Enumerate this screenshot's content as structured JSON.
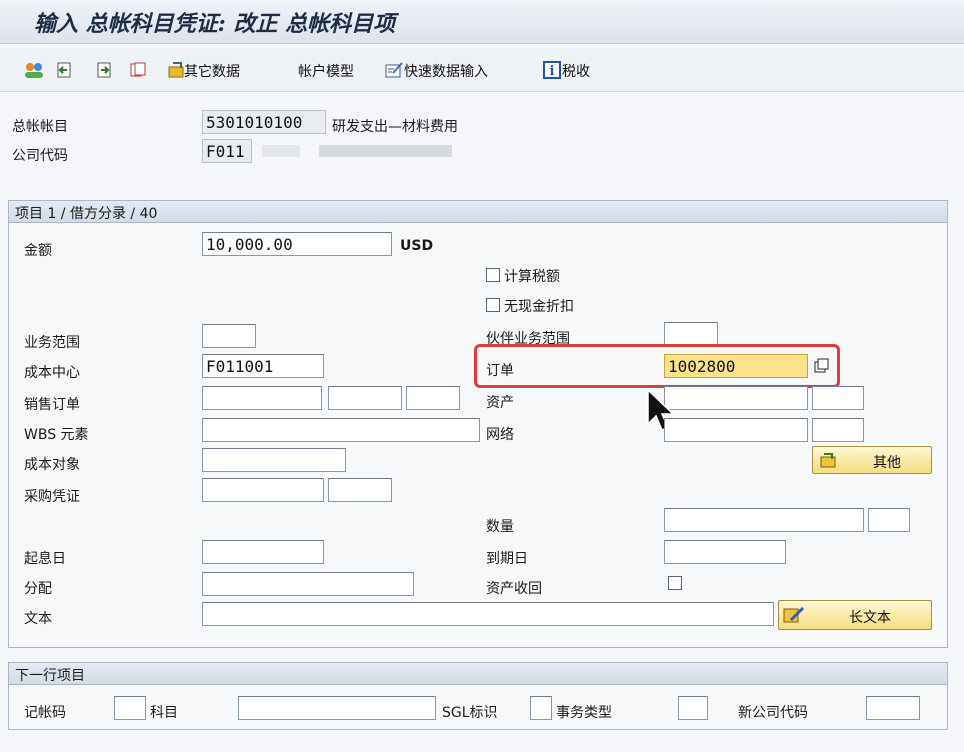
{
  "title": "输入 总帐科目凭证: 改正 总帐科目项",
  "toolbar": {
    "other_data": "其它数据",
    "account_model": "帐户模型",
    "fast_entry": "快速数据输入",
    "tax": "税收"
  },
  "header": {
    "gl_account_label": "总帐帐目",
    "gl_account_value": "5301010100",
    "gl_account_desc": "研发支出—材料费用",
    "company_code_label": "公司代码",
    "company_code_value": "F011"
  },
  "item_panel": {
    "heading": "项目 1 / 借方分录 / 40",
    "amount_label": "金额",
    "amount_value": "10,000.00",
    "currency": "USD",
    "calc_tax": "计算税额",
    "no_cash_discount": "无现金折扣",
    "business_area_label": "业务范围",
    "partner_business_area_label": "伙伴业务范围",
    "cost_center_label": "成本中心",
    "cost_center_value": "F011001",
    "order_label": "订单",
    "order_value": "1002800",
    "sales_order_label": "销售订单",
    "asset_label": "资产",
    "wbs_label": "WBS 元素",
    "network_label": "网络",
    "cost_object_label": "成本对象",
    "other_button": "其他",
    "purchase_doc_label": "采购凭证",
    "quantity_label": "数量",
    "value_date_label": "起息日",
    "due_date_label": "到期日",
    "assignment_label": "分配",
    "asset_retirement_label": "资产收回",
    "text_label": "文本",
    "long_text_button": "长文本"
  },
  "next_item": {
    "heading": "下一行项目",
    "posting_key_label": "记帐码",
    "account_label": "科目",
    "sgl_label": "SGL标识",
    "transaction_type_label": "事务类型",
    "new_company_code_label": "新公司代码"
  },
  "colors": {
    "highlight_field": "#fde28a",
    "annotation_red": "#e23b3b"
  }
}
